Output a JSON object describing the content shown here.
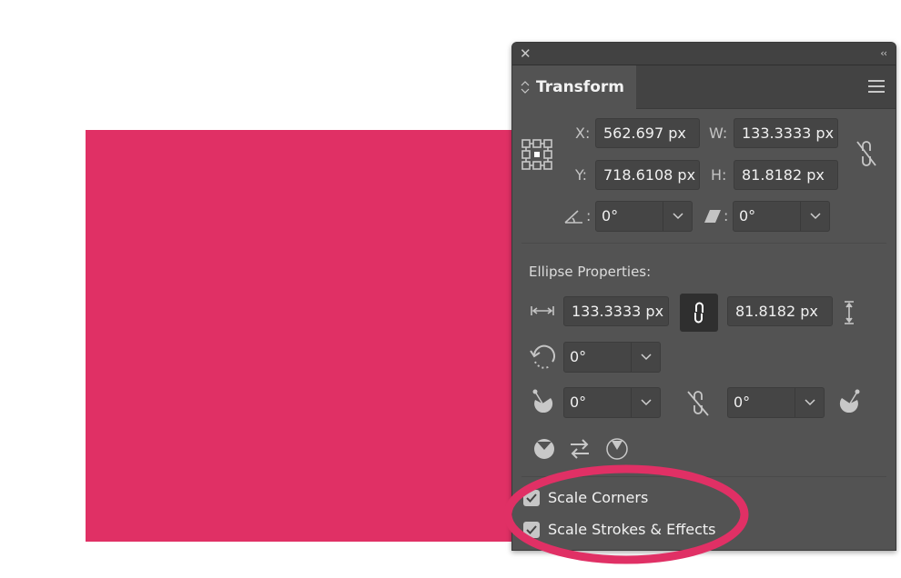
{
  "canvas": {
    "shape_color": "#e03065",
    "annotation_color": "#e03065"
  },
  "panel": {
    "close_glyph": "✕",
    "collapse_glyph": "‹‹",
    "tab_label": "Transform",
    "x_label": "X:",
    "x_value": "562.697 px",
    "y_label": "Y:",
    "y_value": "718.6108 px",
    "w_label": "W:",
    "w_value": "133.3333 px",
    "h_label": "H:",
    "h_value": "81.8182 px",
    "angle_colon": ":",
    "rotate_value": "0°",
    "shear_colon": ":",
    "shear_value": "0°",
    "ellipse_section_title": "Ellipse Properties:",
    "ellipse_width": "133.3333 px",
    "ellipse_height": "81.8182 px",
    "ellipse_rotation": "0°",
    "pie_start_angle": "0°",
    "pie_end_angle": "0°",
    "scale_corners_label": "Scale Corners",
    "scale_corners_checked": true,
    "scale_strokes_label": "Scale Strokes & Effects",
    "scale_strokes_checked": true
  }
}
